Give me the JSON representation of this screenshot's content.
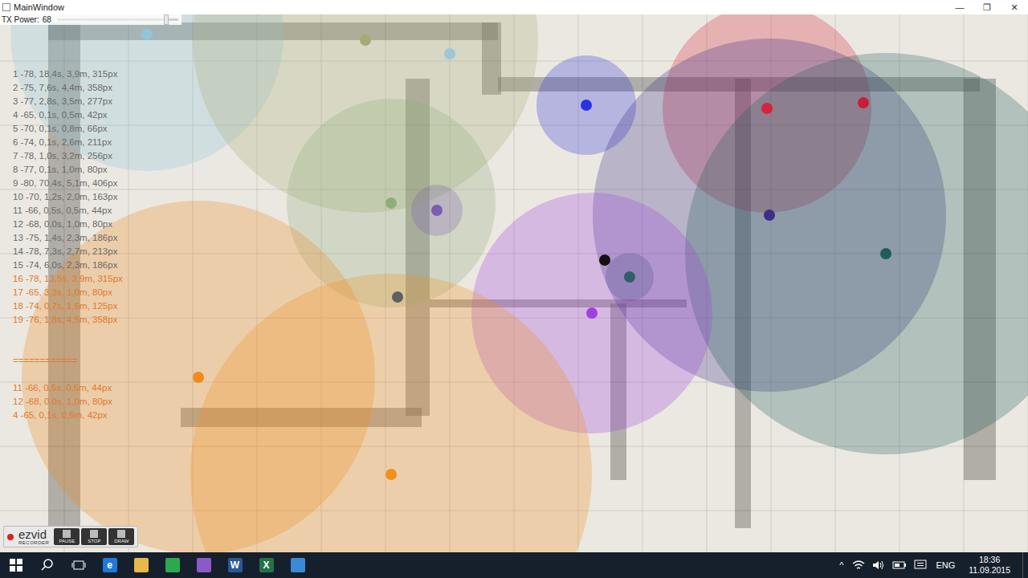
{
  "window": {
    "title": "MainWindow",
    "controls": [
      "—",
      "❐",
      "✕"
    ]
  },
  "tx_power": {
    "label": "TX Power:",
    "value": "68",
    "level": 0.9
  },
  "readings": [
    {
      "text": "1 -78, 18,4s, 3,9m, 315px",
      "color": "#6a6a6a"
    },
    {
      "text": "2 -75, 7,6s, 4,4m, 358px",
      "color": "#6a6a6a"
    },
    {
      "text": "3 -77, 2,8s, 3,5m, 277px",
      "color": "#6a6a6a"
    },
    {
      "text": "4 -65, 0,1s, 0,5m, 42px",
      "color": "#6a6a6a"
    },
    {
      "text": "5 -70, 0,1s, 0,8m, 66px",
      "color": "#6a6a6a"
    },
    {
      "text": "6 -74, 0,1s, 2,6m, 211px",
      "color": "#6a6a6a"
    },
    {
      "text": "7 -78, 1,0s, 3,2m, 256px",
      "color": "#6a6a6a"
    },
    {
      "text": "8 -77, 0,1s, 1,0m, 80px",
      "color": "#6a6a6a"
    },
    {
      "text": "9 -80, 70,4s, 5,1m, 406px",
      "color": "#6a6a6a"
    },
    {
      "text": "10 -70, 1,2s, 2,0m, 163px",
      "color": "#6a6a6a"
    },
    {
      "text": "11 -66, 0,5s, 0,5m, 44px",
      "color": "#6a6a6a"
    },
    {
      "text": "12 -68, 0,0s, 1,0m, 80px",
      "color": "#6a6a6a"
    },
    {
      "text": "13 -75, 1,4s, 2,3m, 186px",
      "color": "#6a6a6a"
    },
    {
      "text": "14 -78, 7,3s, 2,7m, 213px",
      "color": "#6a6a6a"
    },
    {
      "text": "15 -74, 6,0s, 2,3m, 186px",
      "color": "#6a6a6a"
    },
    {
      "text": "16 -78, 13,5s, 3,9m, 315px",
      "color": "#e07a2a"
    },
    {
      "text": "17 -65, 3,3s, 1,0m, 80px",
      "color": "#e07a2a"
    },
    {
      "text": "18 -74, 0,7s, 1,6m, 125px",
      "color": "#e07a2a"
    },
    {
      "text": "19 -76, 1,8s, 4,5m, 358px",
      "color": "#e07a2a"
    }
  ],
  "separator": {
    "text": "============",
    "color": "#e07a2a"
  },
  "nearest": [
    {
      "text": "11 -66, 0,5s, 0,5m, 44px",
      "color": "#e07a2a"
    },
    {
      "text": "12 -68, 0,0s, 1,0m, 80px",
      "color": "#e07a2a"
    },
    {
      "text": "4 -65, 0,1s, 0,5m, 42px",
      "color": "#e07a2a"
    }
  ],
  "beacons": [
    {
      "color": "#8fc6da"
    },
    {
      "color": "#a4ab78"
    },
    {
      "color": "#9cc7d4"
    },
    {
      "color": "#2a33e0"
    },
    {
      "color": "#d8243a"
    },
    {
      "color": "#c81e36"
    },
    {
      "color": "#8fae7a"
    },
    {
      "color": "#7c5cb0"
    },
    {
      "color": "#3a2f8a"
    },
    {
      "color": "#1f5d5a"
    },
    {
      "color": "#111111"
    },
    {
      "color": "#2f5f68"
    },
    {
      "color": "#a040e0"
    },
    {
      "color": "#606060"
    },
    {
      "color": "#f08a1c"
    },
    {
      "color": "#f0901c"
    }
  ],
  "recorder": {
    "brand": "ezvid",
    "sub": "RECORDER",
    "buttons": [
      "PAUSE",
      "STOP",
      "DRAW"
    ]
  },
  "taskbar": {
    "apps": [
      {
        "glyph": "e",
        "color": "#1e7ad6"
      },
      {
        "glyph": "",
        "color": "#e8b84a"
      },
      {
        "glyph": "",
        "color": "#2ea84f"
      },
      {
        "glyph": "",
        "color": "#8a5ac8"
      },
      {
        "glyph": "W",
        "color": "#2b579a"
      },
      {
        "glyph": "X",
        "color": "#217346"
      },
      {
        "glyph": "",
        "color": "#3a8ad8"
      }
    ],
    "tray_arrow": "^",
    "language": "ENG",
    "time": "18:36",
    "date": "11.09.2015"
  }
}
